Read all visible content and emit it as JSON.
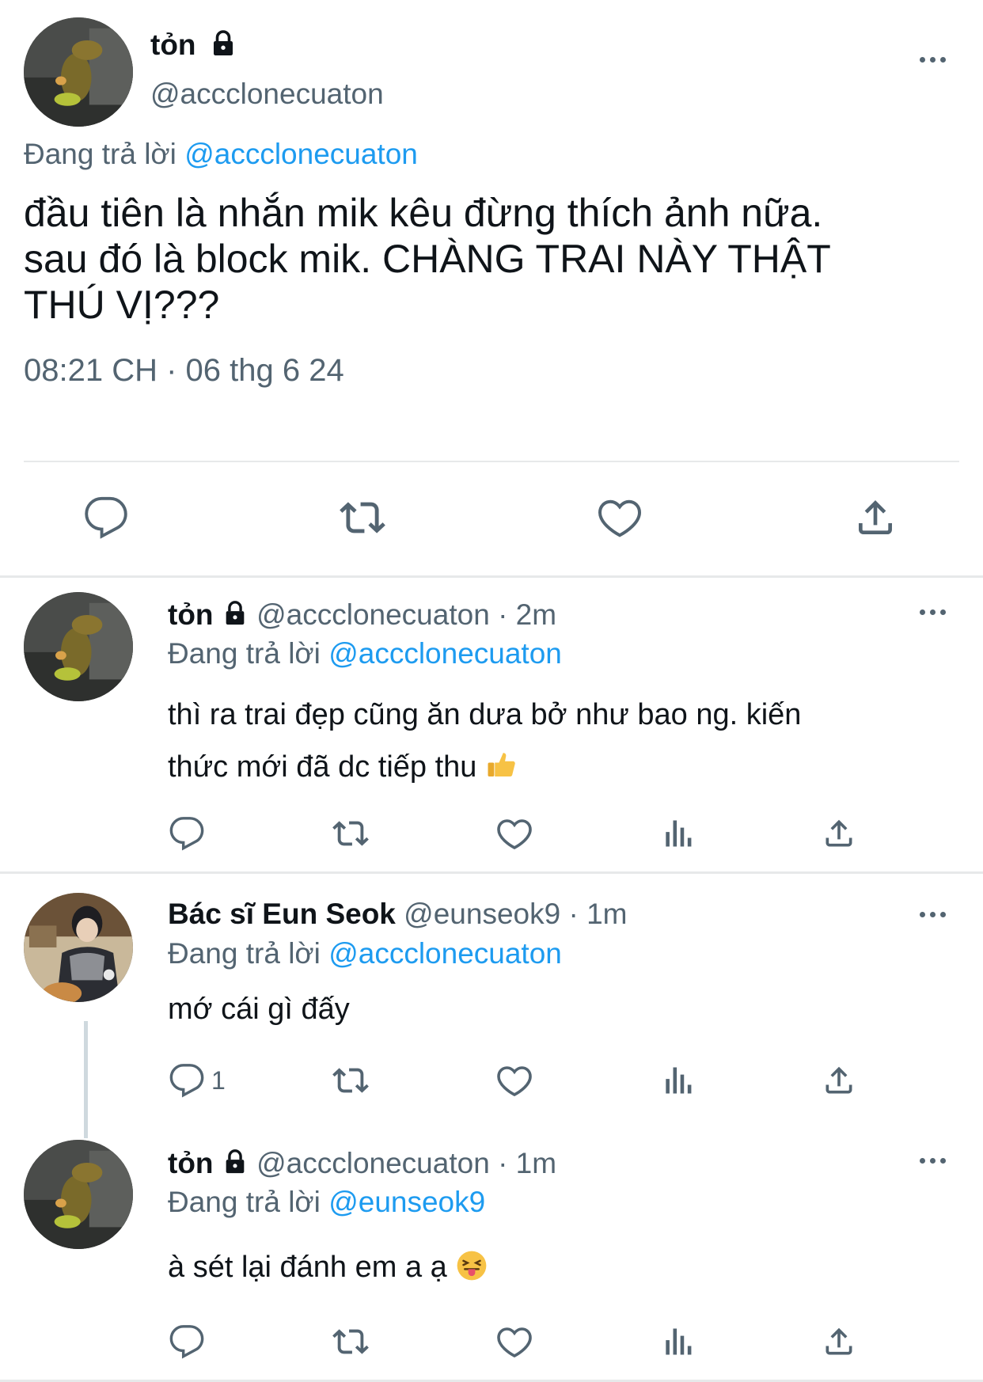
{
  "main_tweet": {
    "author_name": "tỏn",
    "author_handle": "@accclonecuaton",
    "replying_prefix": "Đang trả lời",
    "replying_to": "@accclonecuaton",
    "text_line1": "đầu tiên là nhắn mik kêu đừng thích ảnh nữa.",
    "text_line2": "sau đó là block mik. CHÀNG TRAI NÀY THẬT",
    "text_line3": "THÚ VỊ???",
    "timestamp": "08:21 CH · 06 thg 6 24"
  },
  "replies": [
    {
      "author_name": "tỏn",
      "author_handle": "@accclonecuaton",
      "time": "· 2m",
      "replying_prefix": "Đang trả lời",
      "replying_to": "@accclonecuaton",
      "text_line1": "thì ra trai đẹp cũng ăn dưa bở như bao ng. kiến",
      "text_line2": "thức mới đã dc tiếp thu",
      "reply_count": ""
    },
    {
      "author_name": "Bác sĩ Eun Seok",
      "author_handle": "@eunseok9",
      "time": "· 1m",
      "replying_prefix": "Đang trả lời",
      "replying_to": "@accclonecuaton",
      "text_line1": "mớ cái gì đấy",
      "reply_count": "1"
    },
    {
      "author_name": "tỏn",
      "author_handle": "@accclonecuaton",
      "time": "· 1m",
      "replying_prefix": "Đang trả lời",
      "replying_to": "@eunseok9",
      "text_line1": "à sét lại đánh em a ạ",
      "reply_count": ""
    }
  ],
  "icons": [
    "reply-icon",
    "retweet-icon",
    "like-icon",
    "share-icon",
    "views-icon",
    "more-icon",
    "lock-icon"
  ],
  "colors": {
    "text": "#0f1419",
    "secondary": "#536471",
    "link": "#1d9bf0",
    "divider": "#e7e9ea"
  }
}
